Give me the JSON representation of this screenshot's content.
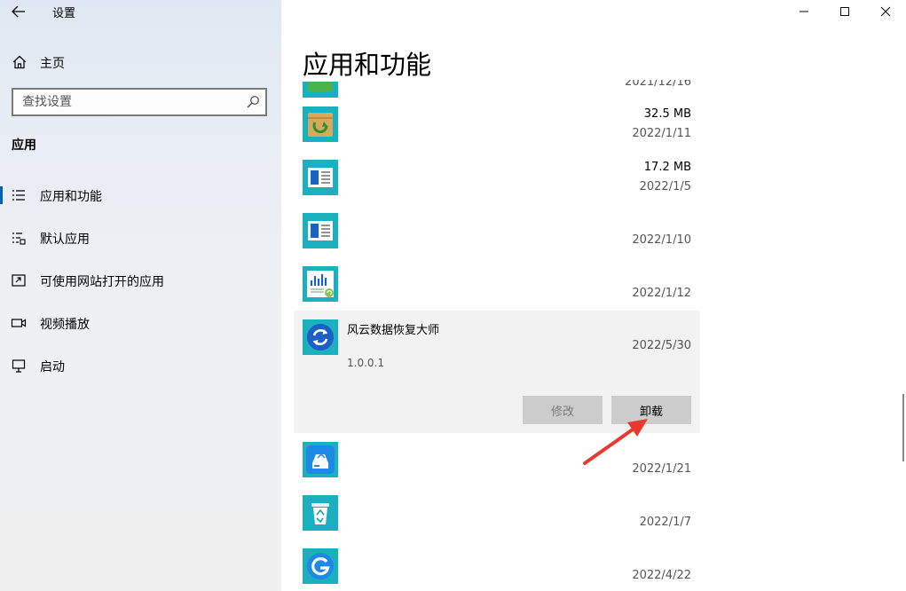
{
  "window": {
    "title": "设置",
    "controls": [
      "minimize",
      "maximize",
      "close"
    ]
  },
  "sidebar": {
    "home_label": "主页",
    "search_placeholder": "查找设置",
    "section_title": "应用",
    "items": [
      {
        "label": "应用和功能",
        "icon": "apps-features-icon",
        "active": true
      },
      {
        "label": "默认应用",
        "icon": "default-apps-icon",
        "active": false
      },
      {
        "label": "可使用网站打开的应用",
        "icon": "apps-for-websites-icon",
        "active": false
      },
      {
        "label": "视频播放",
        "icon": "video-playback-icon",
        "active": false
      },
      {
        "label": "启动",
        "icon": "startup-icon",
        "active": false
      }
    ]
  },
  "main": {
    "title": "应用和功能",
    "partial_date": "2021/12/16",
    "apps": [
      {
        "size": "32.5 MB",
        "date": "2022/1/11",
        "icon": "package-icon"
      },
      {
        "size": "17.2 MB",
        "date": "2022/1/5",
        "icon": "document-window-icon"
      },
      {
        "size": "",
        "date": "2022/1/10",
        "icon": "document-window-icon"
      },
      {
        "size": "",
        "date": "2022/1/12",
        "icon": "chart-report-icon"
      },
      {
        "name": "风云数据恢复大师",
        "version": "1.0.0.1",
        "date": "2022/5/30",
        "icon": "recovery-icon",
        "expanded": true,
        "modify_label": "修改",
        "uninstall_label": "卸载"
      },
      {
        "size": "",
        "date": "2022/1/21",
        "icon": "drive-icon"
      },
      {
        "size": "",
        "date": "2022/1/7",
        "icon": "recycle-bin-icon"
      },
      {
        "size": "",
        "date": "2022/4/22",
        "icon": "g-logo-icon"
      }
    ]
  },
  "colors": {
    "accent": "#0063b1",
    "icon_tile": "#1ab0c0",
    "annotation_arrow": "#e8392f"
  }
}
